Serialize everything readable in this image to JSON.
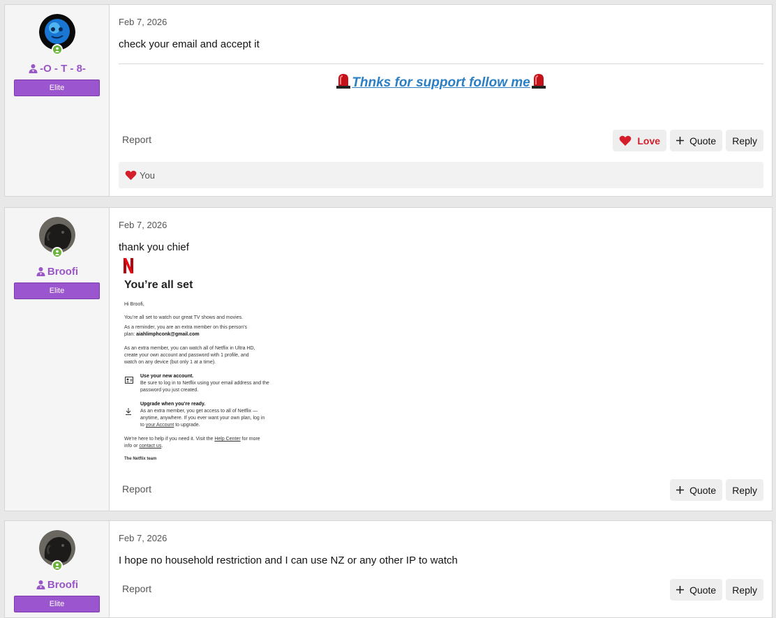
{
  "posts": [
    {
      "username": "-O - T - 8-",
      "badge": "Elite",
      "date": "Feb 7, 2026",
      "text": "check your email and accept it",
      "signature": "Thnks for support follow me",
      "report_label": "Report",
      "love_label": "Love",
      "quote_label": "Quote",
      "reply_label": "Reply",
      "reaction_user": "You"
    },
    {
      "username": "Broofi",
      "badge": "Elite",
      "date": "Feb 7, 2026",
      "text": "thank you chief",
      "report_label": "Report",
      "quote_label": "Quote",
      "reply_label": "Reply",
      "email_image": {
        "heading": "You’re all set",
        "greeting": "Hi Broofi,",
        "line1": "You’re all set to watch our great TV shows and movies.",
        "line2a": "As a reminder, you are an extra member on this person's",
        "line2b": "plan: ",
        "email": "aiahlimphconk@gmail.com",
        "line3": "As an extra member, you can watch all of Netflix in Ultra HD, create your own account and password with 1 profile, and watch on any device (but only 1 at a time).",
        "item1_title": "Use your new account.",
        "item1_body": "Be sure to log in to Netflix using your email address and the password you just created.",
        "item2_title": "Upgrade when you’re ready.",
        "item2_body_a": "As an extra member, you get access to all of Netflix — anytime, anywhere. If you ever want your own plan, log in to ",
        "item2_link": "your Account",
        "item2_body_b": " to upgrade.",
        "help_a": "We’re here to help if you need it. Visit the ",
        "help_link": "Help Center",
        "help_b": " for more info or ",
        "contact_link": "contact us",
        "help_c": ".",
        "signoff": "The Netflix team"
      }
    },
    {
      "username": "Broofi",
      "badge": "Elite",
      "date": "Feb 7, 2026",
      "text": "I hope no household restriction and I can use NZ or any other IP to watch",
      "report_label": "Report",
      "quote_label": "Quote",
      "reply_label": "Reply"
    }
  ],
  "colors": {
    "username": "#9a55c8",
    "badge": "#9b55cf",
    "love": "#d41f2b",
    "signature_link": "#2b7fc4",
    "online": "#6bb33b"
  },
  "icons": [
    "user-shield-icon",
    "online-person-icon",
    "heart-icon",
    "plus-icon",
    "siren-icon",
    "netflix-logo-icon",
    "id-card-icon",
    "download-icon"
  ]
}
